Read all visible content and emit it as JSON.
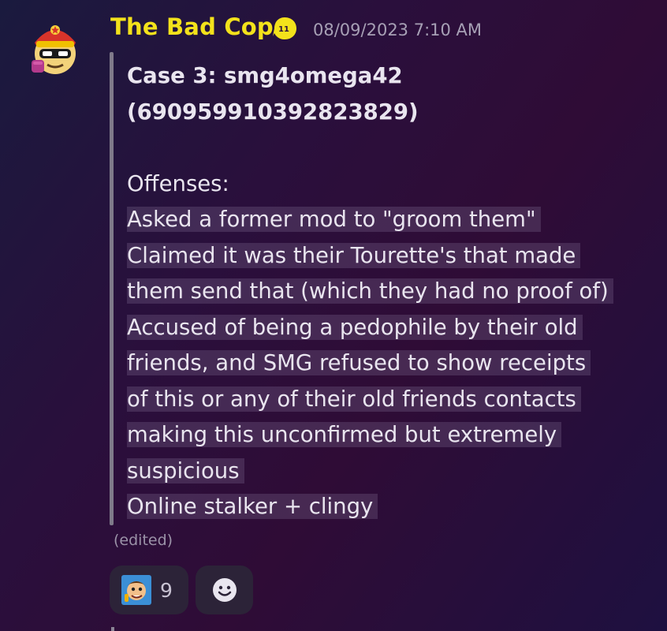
{
  "message": {
    "author": "The Bad Cop",
    "timestamp": "08/09/2023 7:10 AM",
    "badge_icon": "role-badge-icon",
    "title_lines": [
      "Case 3: smg4omega42",
      "(690959910392823829)"
    ],
    "body_lines": [
      "Offenses:",
      "Asked a former mod to \"groom them\"",
      "Claimed it was their Tourette's that made",
      "them send that (which they had no proof of)",
      "Accused of being a pedophile by their old",
      "friends, and SMG refused to show receipts",
      "of this or any of their old friends contacts",
      "making this unconfirmed but extremely",
      "suspicious",
      "Online stalker + clingy"
    ],
    "edited_label": "(edited)"
  },
  "reactions": [
    {
      "emoji": "character-face-emoji",
      "count": "9"
    },
    {
      "emoji": "add-reaction-icon",
      "count": ""
    }
  ],
  "colors": {
    "author": "#f3e21b",
    "timestamp": "#a7a0b5",
    "text": "#e9e5ef",
    "reaction_bg": "#2c2338"
  }
}
